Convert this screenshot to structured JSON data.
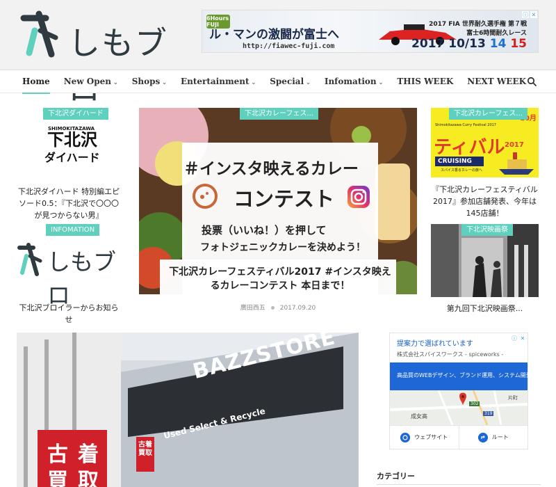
{
  "site": {
    "logo_text": "しもブロ",
    "brand_color": "#5fd0be"
  },
  "ad_banner": {
    "logo_text": "6Hours FUJI",
    "main_text": "ル・マンの激闘が富士へ",
    "url": "http://fiawec-fuji.com",
    "right_line1": "2017 FIA 世界耐久選手権 第７戦",
    "right_line2": "富士6時間耐久レース",
    "date_prefix": "2017 10/13",
    "date_sat": "14",
    "date_sun": "15"
  },
  "nav": {
    "items": [
      {
        "label": "Home",
        "active": true,
        "has_menu": false
      },
      {
        "label": "New Open",
        "has_menu": true
      },
      {
        "label": "Shops",
        "has_menu": true
      },
      {
        "label": "Entertainment",
        "has_menu": true
      },
      {
        "label": "Special",
        "has_menu": true
      },
      {
        "label": "Infomation",
        "has_menu": true
      },
      {
        "label": "THIS WEEK",
        "has_menu": false
      },
      {
        "label": "NEXT WEEK",
        "has_menu": false
      }
    ],
    "chevron": "⌄",
    "search_icon": "search-icon"
  },
  "left_cards": [
    {
      "category": "下北沢ダイハード",
      "thumb_small": "SHIMOKITAZAWA",
      "thumb_big1": "下北沢",
      "thumb_big2": "ダイハード",
      "title": "下北沢ダイハード 特別編エピソード0.5：『下北沢で〇〇〇が見つからない男』"
    },
    {
      "category": "INFOMATION",
      "title": "下北沢ブロイラーからお知らせ"
    }
  ],
  "feature": {
    "category": "下北沢カレーフェス...",
    "headline": "＃インスタ映えるカレー",
    "headline2": "コンテスト",
    "sub1": "投票（いいね！）を押して",
    "sub2": "フォトジェニックカレーを決めよう！",
    "title": "下北沢カレーフェスティバル2017 #インスタ映えるカレーコンテスト 本日まで！",
    "author": "廣田西五",
    "date": "2017.09.20"
  },
  "right_cards": [
    {
      "category": "下北沢カレーフェス...",
      "thumb_text1": "Shimokitazawa Curry Festival 2017",
      "thumb_text2": "ティバル",
      "thumb_text3": "2017",
      "thumb_text4": "10月",
      "thumb_text5": "CRUISING",
      "thumb_text6": "スパイス香るカレーの旅へ",
      "title": "『下北沢カレーフェスティバル2017』参加店舗発表、今年は145店舗！"
    },
    {
      "category": "下北沢映画祭",
      "title": "第九回下北沢映画祭..."
    }
  ],
  "big_image": {
    "sign_text": "BAZZSTORE",
    "sign_sub": "Used Select & Recycle",
    "left_sign1": "古",
    "left_sign2": "着",
    "left_sign3": "買",
    "left_sign4": "取",
    "shop_small": "古着 買取"
  },
  "side_ad": {
    "title": "提案力で選ばれています",
    "advertiser": "株式会社スパイスワークス - spiceworks -",
    "description": "高品質のWEBデザイン、ブランド運用、システム開発。",
    "map_label1": "成女高",
    "map_label2": "片町",
    "map_label3": "302",
    "map_label4": "319",
    "button1": "ウェブサイト",
    "button2": "ルート"
  },
  "sidebar": {
    "heading": "カテゴリー"
  }
}
